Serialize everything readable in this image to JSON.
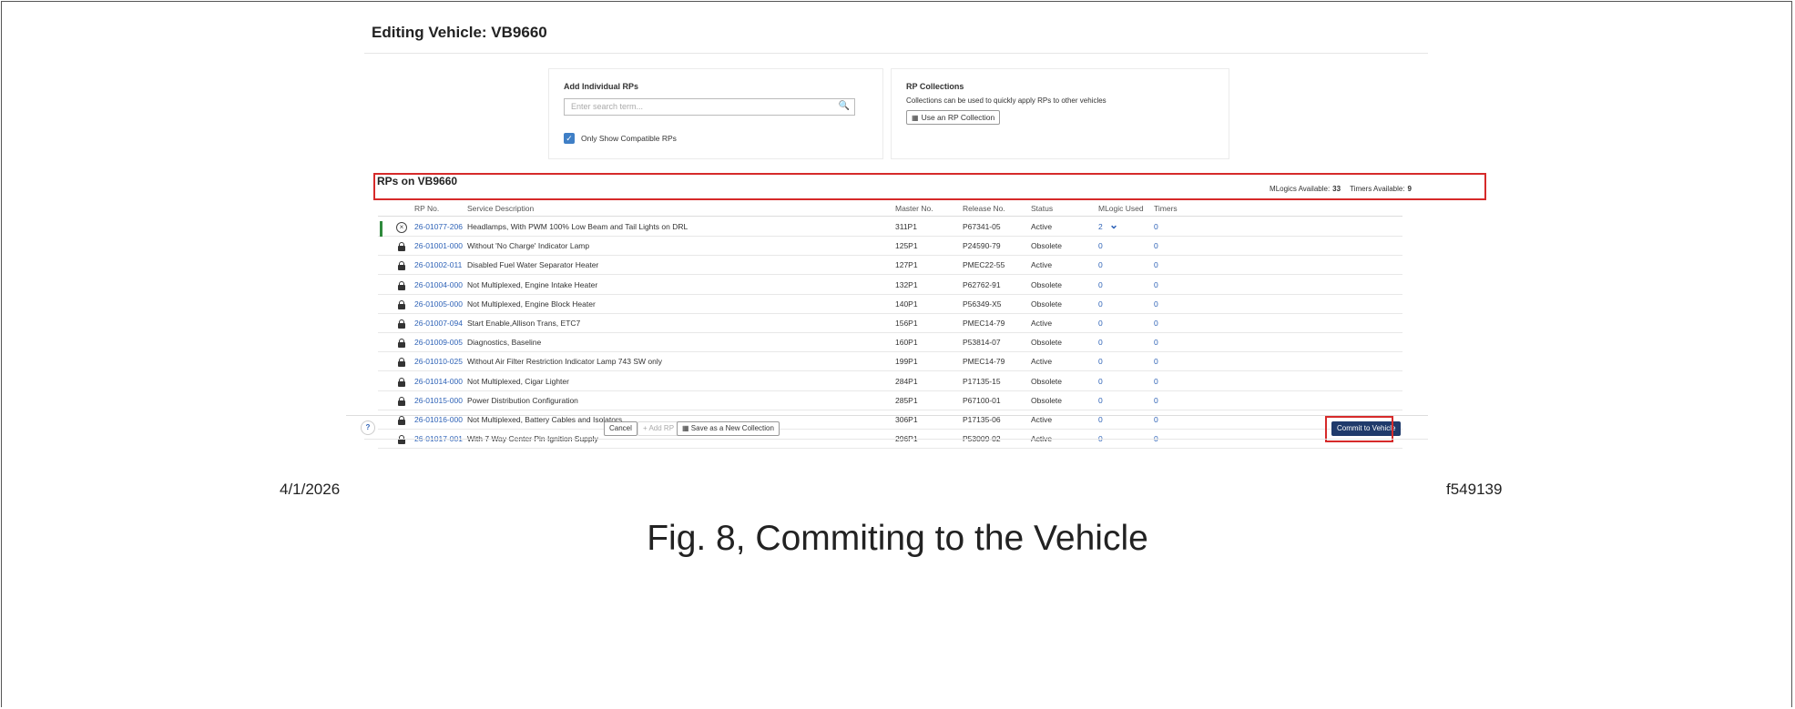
{
  "page_title": "Editing Vehicle: VB9660",
  "add_panel": {
    "title": "Add Individual RPs",
    "search_placeholder": "Enter search term...",
    "checkbox_label": "Only Show Compatible RPs",
    "checkbox_checked": true
  },
  "collections_panel": {
    "title": "RP Collections",
    "description": "Collections can be used to quickly apply RPs to other vehicles",
    "button_label": "Use an RP Collection"
  },
  "rps_section_title": "RPs on VB9660",
  "counts": {
    "mlogics_label": "MLogics Available:",
    "mlogics_value": "33",
    "timers_label": "Timers Available:",
    "timers_value": "9"
  },
  "table": {
    "headers": [
      "RP No.",
      "Service Description",
      "Master No.",
      "Release No.",
      "Status",
      "MLogic Used",
      "Timers"
    ],
    "rows": [
      {
        "rp": "26-01077-206",
        "desc": "Headlamps, With PWM 100% Low Beam and Tail Lights on DRL",
        "master": "311P1",
        "release": "P67341-05",
        "status": "Active",
        "mlogic": "2",
        "timers": "0",
        "icon": "remove-circle-icon",
        "selected": true
      },
      {
        "rp": "26-01001-000",
        "desc": "Without 'No Charge' Indicator Lamp",
        "master": "125P1",
        "release": "P24590-79",
        "status": "Obsolete",
        "mlogic": "0",
        "timers": "0",
        "icon": "lock-icon"
      },
      {
        "rp": "26-01002-011",
        "desc": "Disabled Fuel Water Separator Heater",
        "master": "127P1",
        "release": "PMEC22-55",
        "status": "Active",
        "mlogic": "0",
        "timers": "0",
        "icon": "lock-icon"
      },
      {
        "rp": "26-01004-000",
        "desc": "Not Multiplexed, Engine Intake Heater",
        "master": "132P1",
        "release": "P62762-91",
        "status": "Obsolete",
        "mlogic": "0",
        "timers": "0",
        "icon": "lock-icon"
      },
      {
        "rp": "26-01005-000",
        "desc": "Not Multiplexed, Engine Block Heater",
        "master": "140P1",
        "release": "P56349-X5",
        "status": "Obsolete",
        "mlogic": "0",
        "timers": "0",
        "icon": "lock-icon"
      },
      {
        "rp": "26-01007-094",
        "desc": "Start Enable,Allison Trans, ETC7",
        "master": "156P1",
        "release": "PMEC14-79",
        "status": "Active",
        "mlogic": "0",
        "timers": "0",
        "icon": "lock-icon"
      },
      {
        "rp": "26-01009-005",
        "desc": "Diagnostics, Baseline",
        "master": "160P1",
        "release": "P53814-07",
        "status": "Obsolete",
        "mlogic": "0",
        "timers": "0",
        "icon": "lock-icon"
      },
      {
        "rp": "26-01010-025",
        "desc": "Without Air Filter Restriction Indicator Lamp 743 SW only",
        "master": "199P1",
        "release": "PMEC14-79",
        "status": "Active",
        "mlogic": "0",
        "timers": "0",
        "icon": "lock-icon"
      },
      {
        "rp": "26-01014-000",
        "desc": "Not Multiplexed, Cigar Lighter",
        "master": "284P1",
        "release": "P17135-15",
        "status": "Obsolete",
        "mlogic": "0",
        "timers": "0",
        "icon": "lock-icon"
      },
      {
        "rp": "26-01015-000",
        "desc": "Power Distribution Configuration",
        "master": "285P1",
        "release": "P67100-01",
        "status": "Obsolete",
        "mlogic": "0",
        "timers": "0",
        "icon": "lock-icon"
      },
      {
        "rp": "26-01016-000",
        "desc": "Not Multiplexed, Battery Cables and Isolators",
        "master": "306P1",
        "release": "P17135-06",
        "status": "Active",
        "mlogic": "0",
        "timers": "0",
        "icon": "lock-icon"
      },
      {
        "rp": "26-01017-001",
        "desc": "With 7 Way Center Pin Ignition Supply",
        "master": "296P1",
        "release": "P53009-02",
        "status": "Active",
        "mlogic": "0",
        "timers": "0",
        "icon": "lock-icon"
      }
    ]
  },
  "footer": {
    "help": "?",
    "cancel": "Cancel",
    "add_rp": "+ Add RP",
    "save_collection": "Save as a New Collection",
    "commit": "Commit to Vehicle"
  },
  "doc": {
    "date": "4/1/2026",
    "figure_id": "f549139",
    "caption": "Fig. 8, Commiting to the Vehicle"
  },
  "colors": {
    "link": "#2f63b7",
    "highlight": "#d62a2a",
    "primary_button": "#1f3a6b",
    "active_bar": "#2f8a3c"
  }
}
